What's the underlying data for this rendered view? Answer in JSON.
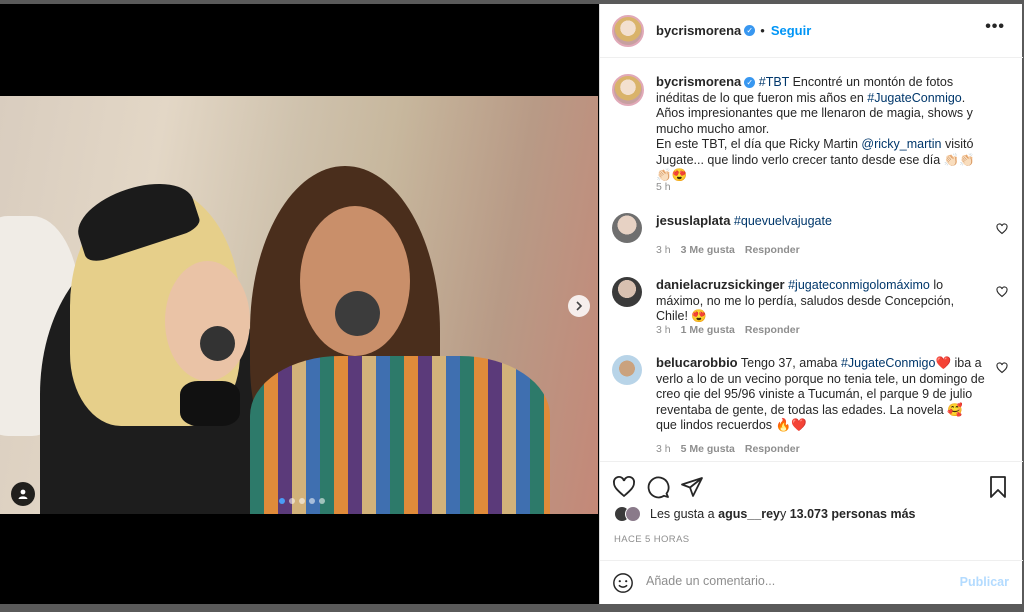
{
  "post": {
    "username": "bycrismorena",
    "follow_label": "Seguir",
    "more_icon": "more-horizontal-icon"
  },
  "caption": {
    "username": "bycrismorena",
    "tag1": "#TBT",
    "text1": " Encontré un montón de fotos inéditas de lo que fueron mis años en ",
    "tag2": "#JugateConmigo",
    "text2": ". Años impresionantes que me llenaron de magia, shows y mucho mucho amor.",
    "text3": "En este TBT, el día que Ricky Martin ",
    "mention": "@ricky_martin",
    "text4": " visitó Jugate... que lindo verlo crecer tanto desde ese día 👏🏻👏🏻👏🏻😍",
    "time": "5 h"
  },
  "comments": [
    {
      "username": "jesuslaplata",
      "text": "",
      "tag": "#quevuelvajugate",
      "after": "",
      "time": "3 h",
      "likes": "3 Me gusta",
      "reply": "Responder"
    },
    {
      "username": "danielacruzsickinger",
      "text": "",
      "tag": "#jugateconmigolomáximo",
      "after": " lo máximo, no me lo perdía, saludos desde Concepción, Chile! 😍",
      "time": "3 h",
      "likes": "1 Me gusta",
      "reply": "Responder"
    },
    {
      "username": "belucarobbio",
      "text": " Tengo 37, amaba ",
      "tag": "#JugateConmigo",
      "after": "❤️ iba a verlo a lo de un vecino porque no tenia tele, un domingo de creo qie del 95/96 viniste a Tucumán, el parque 9 de julio reventaba de gente, de todas las edades. La novela 🥰 que lindos recuerdos 🔥❤️",
      "time": "3 h",
      "likes": "5 Me gusta",
      "reply": "Responder"
    }
  ],
  "likes": {
    "prefix": "Les gusta a ",
    "user": "agus__rey",
    "middle": " y ",
    "count": "13.073 personas más"
  },
  "timestamp": "HACE 5 HORAS",
  "composer": {
    "placeholder": "Añade un comentario...",
    "publish_label": "Publicar"
  },
  "carousel": {
    "total": 5,
    "active_index": 0
  },
  "colors": {
    "link": "#0095f6",
    "tag": "#00376b",
    "muted": "#8e8e8e",
    "publish_disabled": "#b3dbff"
  }
}
